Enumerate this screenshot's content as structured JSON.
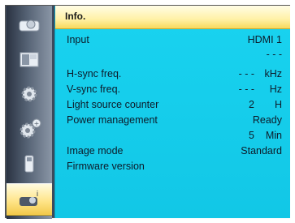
{
  "panel": {
    "title": "Info."
  },
  "sidebar": {
    "items": [
      {
        "icon": "display-icon",
        "active": false
      },
      {
        "icon": "image-adjust-icon",
        "active": false
      },
      {
        "icon": "gear-icon",
        "active": false
      },
      {
        "icon": "gear-plus-icon",
        "active": false
      },
      {
        "icon": "usb-drive-icon",
        "active": false
      },
      {
        "icon": "info-projector-icon",
        "active": true
      }
    ]
  },
  "info": {
    "input": {
      "label": "Input",
      "value": "HDMI 1"
    },
    "input_sub": {
      "value": "- - -"
    },
    "hsync": {
      "label": "H-sync freq.",
      "value": "- - -",
      "unit": "kHz"
    },
    "vsync": {
      "label": "V-sync freq.",
      "value": "- - -",
      "unit": "Hz"
    },
    "light": {
      "label": "Light source counter",
      "value": "2",
      "unit": "H"
    },
    "power": {
      "label": "Power management",
      "value": "Ready"
    },
    "power_sub": {
      "value": "5",
      "unit": "Min"
    },
    "image_mode": {
      "label": "Image mode",
      "value": "Standard"
    },
    "firmware": {
      "label": "Firmware version",
      "value": ""
    }
  },
  "colors": {
    "panel": "#14cbe9",
    "title_bar": "#fff1a6",
    "sidebar": "#556274"
  }
}
